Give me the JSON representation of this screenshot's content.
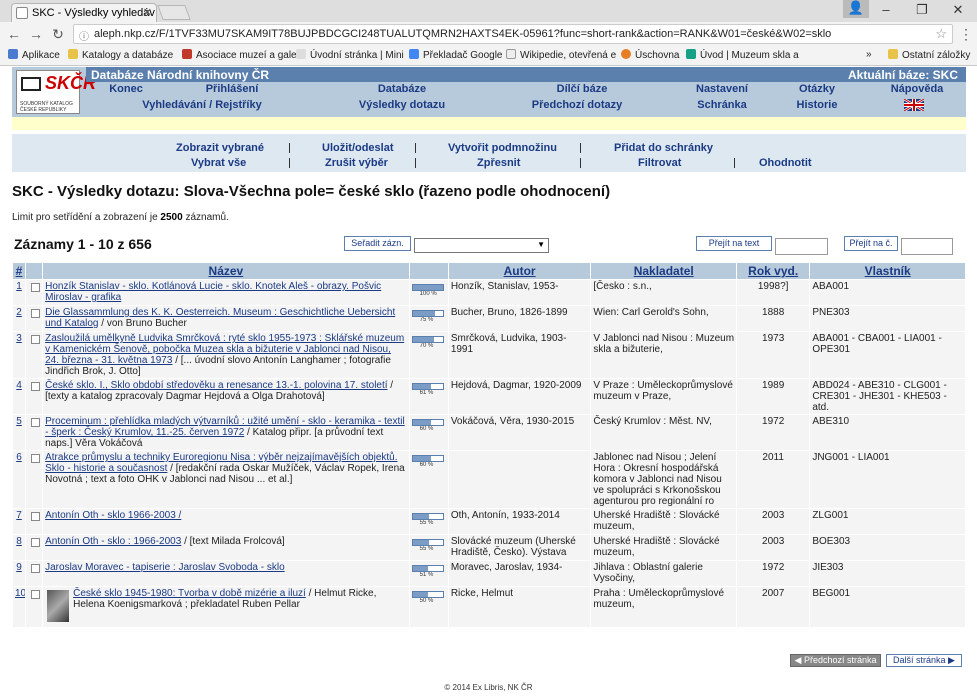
{
  "browser": {
    "tab_title": "SKC - Výsledky vyhledáv",
    "url": "aleph.nkp.cz/F/1TVF33MU7SKAM9IT78BUJPBDCGCI248TUALUTQMRN2HAXTS4EK-05961?func=short-rank&action=RANK&W01=české&W02=sklo",
    "bookmarks": [
      "Aplikace",
      "Katalogy a databáze",
      "Asociace muzeí a gale",
      "Úvodní stránka | Mini",
      "Překladač Google",
      "Wikipedie, otevřená e",
      "Úschovna",
      "Úvod | Muzeum skla a",
      "»",
      "Ostatní záložky"
    ]
  },
  "header": {
    "db_title": "Databáze Národní knihovny ČR",
    "current_db": "Aktuální báze: SKC",
    "logo_text": "SKČR",
    "logo_caption": "SOUBORNÝ KATALOG ČESKÉ REPUBLIKY",
    "menu1": [
      "Konec",
      "Přihlášení",
      "Databáze",
      "Dílčí báze",
      "Nastavení",
      "Otázky",
      "Nápověda"
    ],
    "menu2": [
      "Vyhledávání / Rejstříky",
      "Výsledky dotazu",
      "Předchozí dotazy",
      "Schránka",
      "Historie"
    ]
  },
  "toolbar": {
    "row1": [
      "Zobrazit vybrané",
      "Uložit/odeslat",
      "Vytvořit podmnožinu",
      "Přidat do schránky"
    ],
    "row2": [
      "Vybrat vše",
      "Zrušit výběr",
      "Zpřesnit",
      "Filtrovat",
      "Ohodnotit"
    ]
  },
  "page": {
    "title": "SKC - Výsledky dotazu:  Slova-Všechna pole= české sklo  (řazeno podle ohodnocení)",
    "limit_prefix": "Limit pro setřídění a zobrazení je ",
    "limit_value": "2500",
    "limit_suffix": " záznamů.",
    "records": "Záznamy 1 - 10 z 656",
    "sort_button": "Seřadit zázn.",
    "jump_text": "Přejít na text",
    "jump_num": "Přejít na č."
  },
  "table": {
    "headers": [
      "#",
      "Název",
      "Autor",
      "Nakladatel",
      "Rok vyd.",
      "Vlastník"
    ],
    "rows": [
      {
        "num": "1",
        "title": "Honzík Stanislav - sklo. Kotlánová Lucie - sklo. Knotek Aleš - obrazy. Pošvic Miroslav - grafika",
        "rest": "",
        "score": 100,
        "score_label": "100 %",
        "author": "Honzík, Stanislav, 1953-",
        "publisher": "[Česko : s.n.,",
        "year": "1998?]",
        "owner": "ABA001"
      },
      {
        "num": "2",
        "title": "Die Glassammlung des K. K. Oesterreich. Museum : Geschichtliche Uebersicht und Katalog",
        "rest": " / von Bruno Bucher",
        "score": 75,
        "score_label": "75 %",
        "author": "Bucher, Bruno, 1826-1899",
        "publisher": "Wien: Carl Gerold's Sohn,",
        "year": "1888",
        "owner": "PNE303"
      },
      {
        "num": "3",
        "title": "Zasloužilá umělkyně Ludvika Smrčková : ryté sklo 1955-1973 : Sklářské muzeum v Kamenickém Šenově, pobočka Muzea skla a bižuterie v Jablonci nad Nisou, 24. března - 31. května 1973",
        "rest": " / [... úvodní slovo Antonín Langhamer ; fotografie Jindřich Brok, J. Otto]",
        "score": 70,
        "score_label": "70 %",
        "author": "Smrčková, Ludvika, 1903-1991",
        "publisher": "V Jablonci nad Nisou : Muzeum skla a bižuterie,",
        "year": "1973",
        "owner": "ABA001 - CBA001 - LIA001 - OPE301"
      },
      {
        "num": "4",
        "title": "České sklo. I., Sklo období středověku a renesance 13.-1. polovina 17. století",
        "rest": " / [texty a katalog zpracovaly Dagmar Hejdová a Olga Drahotová]",
        "score": 61,
        "score_label": "61 %",
        "author": "Hejdová, Dagmar, 1920-2009",
        "publisher": "V Praze : Uměleckoprůmyslové muzeum v Praze,",
        "year": "1989",
        "owner": "ABD024 - ABE310 - CLG001 - CRE301 - JHE301 - KHE503 - atd."
      },
      {
        "num": "5",
        "title": "Proceminum : přehlídka mladých výtvarníků : užité umění - sklo - keramika - textil - šperk : Český Krumlov, 11.-25. červen 1972",
        "rest": " / Katalog připr. [a průvodní text naps.] Věra Vokáčová",
        "score": 60,
        "score_label": "60 %",
        "author": "Vokáčová, Věra, 1930-2015",
        "publisher": "Český Krumlov : Měst. NV,",
        "year": "1972",
        "owner": "ABE310"
      },
      {
        "num": "6",
        "title": "Atrakce průmyslu a techniky Euroregionu Nisa : výběr nejzajímavějších objektů. Sklo - historie a současnost",
        "rest": " / [redakční rada Oskar Mužíček, Václav Ropek, Irena Novotná ; text a foto OHK v Jablonci nad Nisou ... et al.]",
        "score": 60,
        "score_label": "60 %",
        "author": "",
        "publisher": "Jablonec nad Nisou ; Jelení Hora : Okresní hospodářská komora v Jablonci nad Nisou ve spolupráci s Krkonošskou agenturou pro regionální ro",
        "year": "2011",
        "owner": "JNG001 - LIA001"
      },
      {
        "num": "7",
        "title": "Antonín Oth - sklo 1966-2003 /",
        "rest": "",
        "score": 55,
        "score_label": "55 %",
        "author": "Oth, Antonín, 1933-2014",
        "publisher": "Uherské Hradiště : Slovácké muzeum,",
        "year": "2003",
        "owner": "ZLG001"
      },
      {
        "num": "8",
        "title": "Antonín Oth - sklo : 1966-2003",
        "rest": " / [text Milada Frolcová]",
        "score": 55,
        "score_label": "55 %",
        "author": "Slovácké muzeum (Uherské Hradiště, Česko). Výstava",
        "publisher": "Uherské Hradiště : Slovácké muzeum,",
        "year": "2003",
        "owner": "BOE303"
      },
      {
        "num": "9",
        "title": "Jaroslav Moravec - tapiserie : Jaroslav Svoboda - sklo",
        "rest": "",
        "score": 51,
        "score_label": "51 %",
        "author": "Moravec, Jaroslav, 1934-",
        "publisher": "Jihlava : Oblastní galerie Vysočiny,",
        "year": "1972",
        "owner": "JIE303"
      },
      {
        "num": "10",
        "title": "České sklo 1945-1980: Tvorba v době mizérie a iluzí",
        "rest": " / Helmut Ricke, Helena Koenigsmarková ; překladatel Ruben Pellar",
        "score": 50,
        "score_label": "50 %",
        "author": "Ricke, Helmut",
        "publisher": "Praha : Uměleckoprůmyslové muzeum,",
        "year": "2007",
        "owner": "BEG001"
      }
    ]
  },
  "footer": {
    "prev": "◀ Předchozí stránka",
    "next": "Další stránka ▶",
    "copyright": "© 2014 Ex Libris, NK ČR"
  }
}
